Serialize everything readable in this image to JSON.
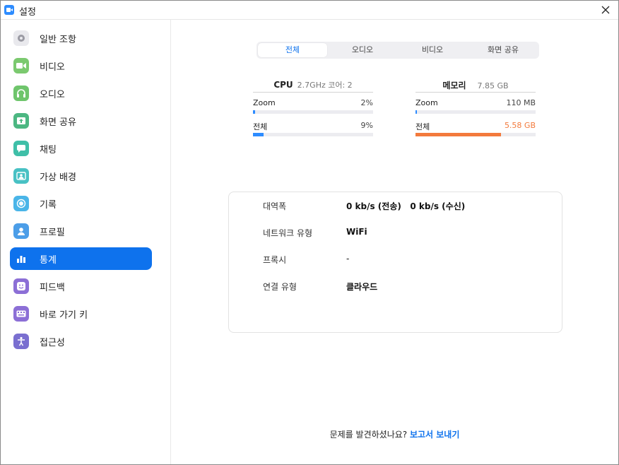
{
  "window": {
    "title": "설정"
  },
  "sidebar": {
    "active_index": 8,
    "items": [
      {
        "label": "일반 조항",
        "icon": "gear-icon",
        "color": "#e8e8ec"
      },
      {
        "label": "비디오",
        "icon": "video-camera-icon",
        "color": "#7bc96f"
      },
      {
        "label": "오디오",
        "icon": "headphones-icon",
        "color": "#7bc96f"
      },
      {
        "label": "화면 공유",
        "icon": "share-screen-icon",
        "color": "#4cb782"
      },
      {
        "label": "채팅",
        "icon": "chat-bubble-icon",
        "color": "#3fbfa8"
      },
      {
        "label": "가상 배경",
        "icon": "virtual-background-icon",
        "color": "#48c1c4"
      },
      {
        "label": "기록",
        "icon": "record-icon",
        "color": "#4ab5e8"
      },
      {
        "label": "프로필",
        "icon": "profile-icon",
        "color": "#4c9ee8"
      },
      {
        "label": "통계",
        "icon": "statistics-icon",
        "color": "#0e72ed"
      },
      {
        "label": "피드백",
        "icon": "feedback-smiley-icon",
        "color": "#8c6fd6"
      },
      {
        "label": "바로 가기 키",
        "icon": "keyboard-icon",
        "color": "#8c6fd6"
      },
      {
        "label": "접근성",
        "icon": "accessibility-icon",
        "color": "#7a6fd0"
      }
    ]
  },
  "tabs": [
    {
      "label": "전체",
      "active": true
    },
    {
      "label": "오디오",
      "active": false
    },
    {
      "label": "비디오",
      "active": false
    },
    {
      "label": "화면 공유",
      "active": false
    }
  ],
  "cpu": {
    "name": "CPU",
    "info": "2.7GHz  코어: 2",
    "rows": [
      {
        "label": "Zoom",
        "value": "2%",
        "fraction": 0.02,
        "color": "#2d8cff"
      },
      {
        "label": "전체",
        "value": "9%",
        "fraction": 0.09,
        "color": "#2d8cff"
      }
    ]
  },
  "memory": {
    "name": "메모리",
    "info": "7.85 GB",
    "rows": [
      {
        "label": "Zoom",
        "value": "110 MB",
        "fraction": 0.014,
        "color": "#2d8cff"
      },
      {
        "label": "전체",
        "value": "5.58 GB",
        "fraction": 0.71,
        "color": "#f37a3c",
        "value_color": "#f37a3c"
      }
    ]
  },
  "network": {
    "rows": [
      {
        "label": "대역폭",
        "value": "0 kb/s (전송)   0 kb/s (수신)"
      },
      {
        "label": "네트워크 유형",
        "value": "WiFi"
      },
      {
        "label": "프록시",
        "value": "-"
      },
      {
        "label": "연결 유형",
        "value": "클라우드"
      }
    ]
  },
  "footer": {
    "question": "문제를 발견하셨나요? ",
    "link": "보고서 보내기"
  }
}
